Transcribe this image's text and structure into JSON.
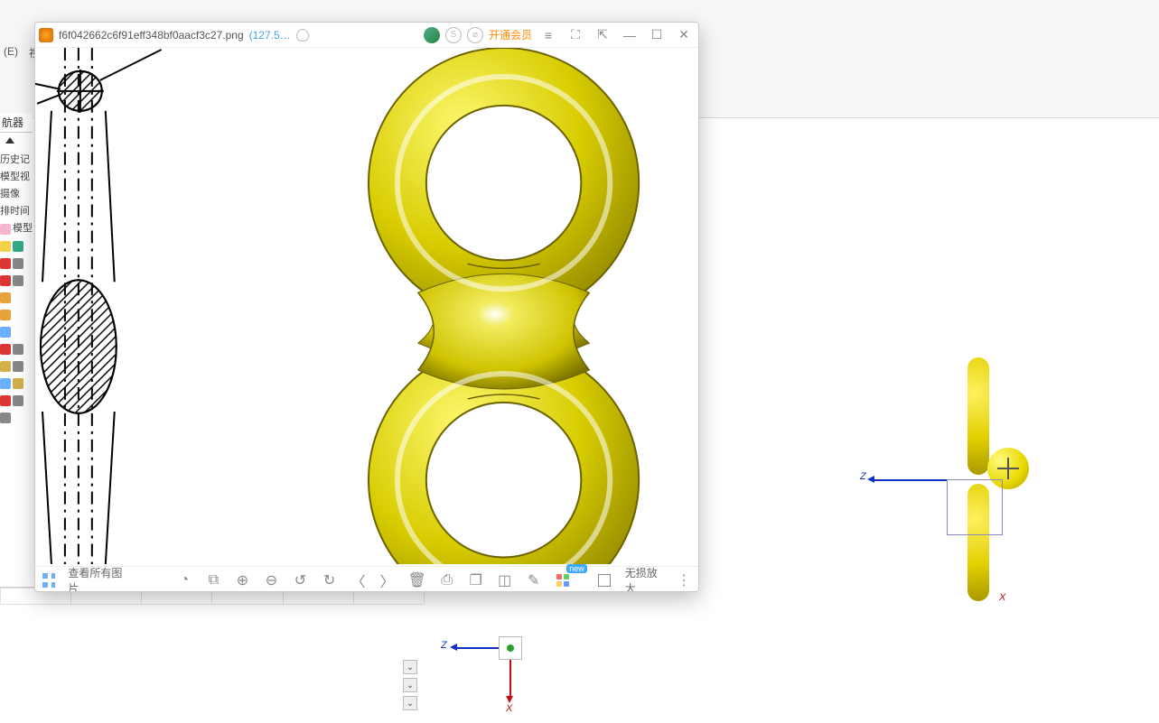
{
  "bg": {
    "menu": [
      "(E)",
      "视"
    ],
    "nav_title": "航器",
    "tree": [
      "历史记",
      "模型视",
      "摄像",
      "排时间",
      "模型"
    ],
    "axes": {
      "z": "Z",
      "x": "X"
    },
    "small_axes": {
      "z": "Z",
      "x": "X"
    }
  },
  "viewer": {
    "filename": "f6f042662c6f91eff348bf0aacf3c27.png",
    "filesize": "(127.5…",
    "vip_label": "开通会员",
    "view_all": "查看所有图片",
    "lossless_zoom": "无损放大",
    "icons": {
      "app": "app-icon",
      "cloud": "cloud-icon",
      "avatar": "avatar-icon",
      "scan": "scan-icon",
      "s": "s-circle-icon",
      "menu": "menu-icon",
      "fullscreen": "fullscreen-icon",
      "pin": "pin-icon",
      "minimize": "minimize-icon",
      "maximize": "maximize-icon",
      "close": "close-icon",
      "grid": "grid-icon",
      "timer": "timer-icon",
      "crop": "crop-icon",
      "zoom_in": "zoom-in-icon",
      "zoom_out": "zoom-out-icon",
      "rotate_l": "rotate-left-icon",
      "rotate_r": "rotate-right-icon",
      "prev": "prev-icon",
      "next": "next-icon",
      "trash": "trash-icon",
      "print": "print-icon",
      "copy": "copy-icon",
      "compare": "compare-icon",
      "edit": "edit-icon",
      "apps": "apps-icon",
      "expand": "expand-icon",
      "more": "more-icon"
    }
  }
}
